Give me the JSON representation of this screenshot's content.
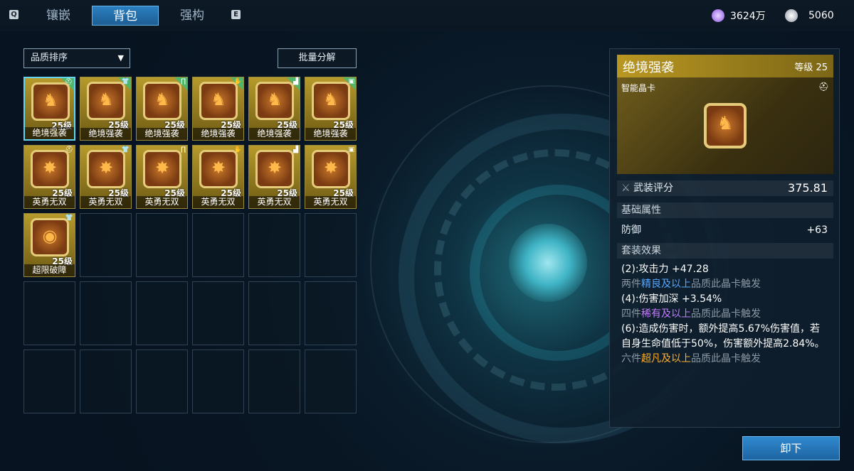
{
  "topbar": {
    "key_left": "Q",
    "key_right": "E",
    "tabs": [
      {
        "label": "镶嵌",
        "active": false
      },
      {
        "label": "背包",
        "active": true
      },
      {
        "label": "强构",
        "active": false
      }
    ],
    "currency1": {
      "icon": "plus-orb-icon",
      "value": "3624万",
      "color": "#b887ff"
    },
    "currency2": {
      "icon": "coin-icon",
      "value": "5060",
      "color": "#c7ced6"
    }
  },
  "controls": {
    "sort_label": "品质排序",
    "batch_label": "批量分解"
  },
  "inventory": {
    "items": [
      {
        "name": "绝境强袭",
        "level": "25级",
        "slot_icon": "helmet-icon",
        "glyph": "figure",
        "quality": "green",
        "selected": true
      },
      {
        "name": "绝境强袭",
        "level": "25级",
        "slot_icon": "shirt-icon",
        "glyph": "figure",
        "quality": "green",
        "selected": false
      },
      {
        "name": "绝境强袭",
        "level": "25级",
        "slot_icon": "pants-icon",
        "glyph": "figure",
        "quality": "green",
        "selected": false
      },
      {
        "name": "绝境强袭",
        "level": "25级",
        "slot_icon": "glove-icon",
        "glyph": "figure",
        "quality": "green",
        "selected": false
      },
      {
        "name": "绝境强袭",
        "level": "25级",
        "slot_icon": "boot-icon",
        "glyph": "figure",
        "quality": "green",
        "selected": false
      },
      {
        "name": "绝境强袭",
        "level": "25级",
        "slot_icon": "backpack-icon",
        "glyph": "figure",
        "quality": "green",
        "selected": false
      },
      {
        "name": "英勇无双",
        "level": "25级",
        "slot_icon": "helmet-icon",
        "glyph": "star",
        "quality": "plain",
        "selected": false
      },
      {
        "name": "英勇无双",
        "level": "25级",
        "slot_icon": "shirt-icon",
        "glyph": "star",
        "quality": "plain",
        "selected": false
      },
      {
        "name": "英勇无双",
        "level": "25级",
        "slot_icon": "pants-icon",
        "glyph": "star",
        "quality": "plain",
        "selected": false
      },
      {
        "name": "英勇无双",
        "level": "25级",
        "slot_icon": "glove-icon",
        "glyph": "star",
        "quality": "plain",
        "selected": false
      },
      {
        "name": "英勇无双",
        "level": "25级",
        "slot_icon": "boot-icon",
        "glyph": "star",
        "quality": "plain",
        "selected": false
      },
      {
        "name": "英勇无双",
        "level": "25级",
        "slot_icon": "backpack-icon",
        "glyph": "star",
        "quality": "plain",
        "selected": false
      },
      {
        "name": "超限破障",
        "level": "25级",
        "slot_icon": "shirt-icon",
        "glyph": "orb",
        "quality": "plain",
        "selected": false
      }
    ],
    "total_slots": 30
  },
  "detail": {
    "title": "绝境强袭",
    "level": "等级 25",
    "category": "智能晶卡",
    "slot_icon": "helmet-icon",
    "score_label": "武装评分",
    "score_value": "375.81",
    "base_section": "基础属性",
    "stat_name": "防御",
    "stat_value": "+63",
    "set_section": "套装效果",
    "set": {
      "line1": "(2):攻击力 +47.28",
      "req1_pre": "两件",
      "req1_q": "精良及以上",
      "req1_post": "品质此晶卡触发",
      "line2": "(4):伤害加深 +3.54%",
      "req2_pre": "四件",
      "req2_q": "稀有及以上",
      "req2_post": "品质此晶卡触发",
      "line3": "(6):造成伤害时，额外提高5.67%伤害值，若自身生命值低于50%，伤害额外提高2.84%。",
      "req3_pre": "六件",
      "req3_q": "超凡及以上",
      "req3_post": "品质此晶卡触发"
    }
  },
  "unequip_label": "卸下"
}
